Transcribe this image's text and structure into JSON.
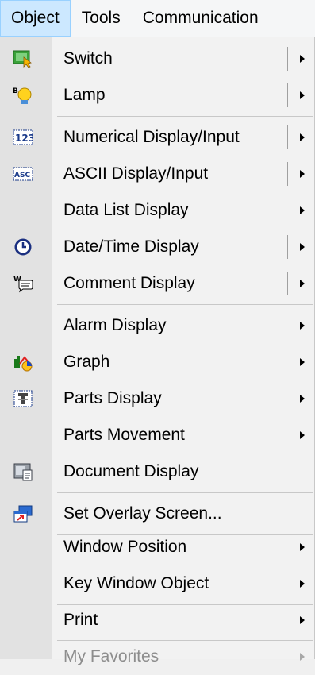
{
  "menubar": {
    "items": [
      {
        "label": "Object"
      },
      {
        "label": "Tools"
      },
      {
        "label": "Communication"
      }
    ]
  },
  "menu": {
    "items": [
      {
        "label": "Switch",
        "icon": "switch-icon",
        "submenu": true
      },
      {
        "label": "Lamp",
        "icon": "lamp-icon",
        "submenu": true
      },
      {
        "label": "Numerical Display/Input",
        "icon": "numeric-123-icon",
        "submenu": true
      },
      {
        "label": "ASCII Display/Input",
        "icon": "ascii-icon",
        "submenu": true
      },
      {
        "label": "Data List Display",
        "icon": "",
        "submenu": true
      },
      {
        "label": "Date/Time Display",
        "icon": "clock-icon",
        "submenu": true
      },
      {
        "label": "Comment Display",
        "icon": "comment-icon",
        "submenu": true
      },
      {
        "label": "Alarm Display",
        "icon": "",
        "submenu": true
      },
      {
        "label": "Graph",
        "icon": "graph-icon",
        "submenu": true
      },
      {
        "label": "Parts Display",
        "icon": "parts-icon",
        "submenu": true
      },
      {
        "label": "Parts Movement",
        "icon": "",
        "submenu": true
      },
      {
        "label": "Document Display",
        "icon": "document-icon",
        "submenu": false
      },
      {
        "label": "Set Overlay Screen...",
        "icon": "overlay-screen-icon",
        "submenu": false
      },
      {
        "label": "Window Position",
        "icon": "",
        "submenu": true
      },
      {
        "label": "Key Window Object",
        "icon": "",
        "submenu": true
      },
      {
        "label": "Print",
        "icon": "",
        "submenu": true
      },
      {
        "label": "My Favorites",
        "icon": "",
        "submenu": true,
        "disabled": true
      }
    ]
  },
  "colors": {
    "menubar_highlight": "#cce8ff",
    "menu_background": "#f2f2f2",
    "icon_gutter": "#e2e2e2",
    "disabled_text": "#8d8d8d"
  }
}
